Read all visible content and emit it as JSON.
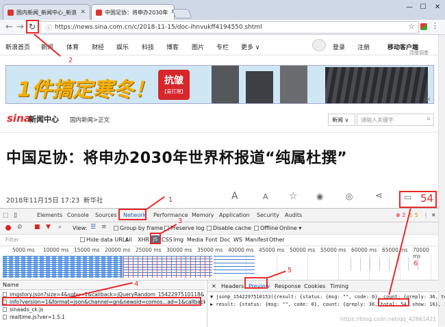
{
  "tabs": [
    {
      "label": "国内新闻_新闻中心_新浪",
      "active": false
    },
    {
      "label": "中国足协：将申办2030年",
      "active": true
    }
  ],
  "window": {
    "minimize": "—",
    "maximize": "☐",
    "close": "✕"
  },
  "address": {
    "url": "https://news.sina.com.cn/c/2018-11-15/doc-ihnvukff4194550.shtml"
  },
  "nav": {
    "items": [
      "新浪首页",
      "新闻",
      "体育",
      "财经",
      "娱乐",
      "科技",
      "博客",
      "图片",
      "专栏",
      "更多 ∨"
    ],
    "login": "登录",
    "register": "注册",
    "mobile": "移动客户端",
    "survey": "改版调查"
  },
  "banner": {
    "text": "1件搞定寒冬！",
    "badge": "抗皱",
    "badge_sub": "【易打理】"
  },
  "header": {
    "logo": "sina",
    "logo_text": "新闻中心",
    "breadcrumb": "国内新闻>正文",
    "search_scope": "新闻",
    "search_placeholder": "请输入关键字"
  },
  "article": {
    "title": "中国足协：将申办2030年世界杯报道“纯属杜撰”",
    "date": "2018年11月15日 17:23",
    "source": "新华社",
    "comment_count": "54"
  },
  "devtools": {
    "tabs": [
      "Elements",
      "Console",
      "Sources",
      "Network",
      "Performance",
      "Memory",
      "Application",
      "Security",
      "Audits"
    ],
    "errors": "2",
    "warnings": "5",
    "toolbar": {
      "view": "View:",
      "group": "Group by frame",
      "preserve": "Preserve log",
      "cache": "Disable cache",
      "offline": "Offline",
      "online": "Online"
    },
    "filter": {
      "placeholder": "Filter",
      "hide": "Hide data URLs",
      "types": [
        "All",
        "XHR",
        "JS",
        "CSS",
        "Img",
        "Media",
        "Font",
        "Doc",
        "WS",
        "Manifest",
        "Other"
      ]
    },
    "ticks": [
      "5000 ms",
      "10000 ms",
      "15000 ms",
      "20000 ms",
      "25000 ms",
      "30000 ms",
      "35000 ms",
      "40000 ms",
      "45000 ms",
      "50000 ms",
      "55000 ms",
      "60000 ms",
      "65000 ms",
      "70000 ms"
    ],
    "req_header": "Name",
    "requests": [
      "imgstory.json?size=4&sohu=1&callback=jQueryRandom_1542297510118&_=1542",
      "info?version=1&format=json&channel=gn&newsid=comos...ad=1&callback=json",
      "sinaads_ck.js",
      "realtime.js?ver=1.5.1"
    ],
    "detail_tabs": [
      "Headers",
      "Preview",
      "Response",
      "Cookies",
      "Timing"
    ],
    "preview": [
      "▼ jsonp_1542297510153({result: {status: {msg: \"\", code: 0}, count: {qreply: 36, tota",
      "  ▶ result: {status: {msg: \"\", code: 0}, count: {qreply: 36, total: 54, show: 16}, 1"
    ]
  },
  "annotations": [
    "1",
    "2",
    "3",
    "4",
    "5",
    "6"
  ],
  "watermark": "https://blog.csdn.net/qq_42861421",
  "colors": {
    "accent": "#e8282b",
    "chrome": "#cfd8e6"
  }
}
